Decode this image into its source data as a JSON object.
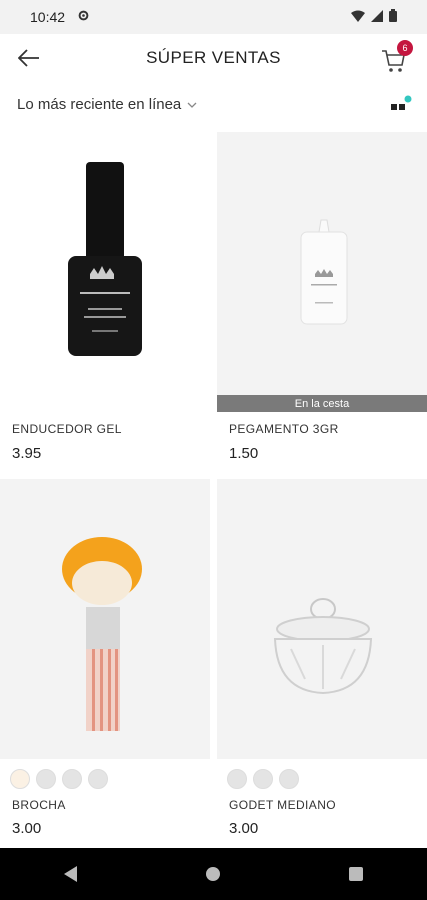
{
  "status_bar": {
    "time": "10:42"
  },
  "header": {
    "title": "SÚPER VENTAS",
    "cart_count": "6"
  },
  "filter": {
    "sort_label": "Lo más reciente en línea"
  },
  "products": [
    {
      "name": "ENDUCEDOR GEL",
      "price": "3.95"
    },
    {
      "name": "PEGAMENTO 3GR",
      "price": "1.50",
      "banner": "En la cesta"
    },
    {
      "name": "BROCHA",
      "price": "3.00"
    },
    {
      "name": "GODET MEDIANO",
      "price": "3.00"
    }
  ],
  "colors": {
    "accent": "#c4163f",
    "teal": "#33c7c0",
    "banner": "#7a7a7a"
  },
  "icons": {
    "status": [
      "gear-icon",
      "wifi-icon",
      "signal-icon",
      "battery-icon"
    ],
    "header": [
      "back-arrow-icon",
      "cart-icon"
    ],
    "nav": [
      "back-triangle-icon",
      "home-circle-icon",
      "recents-square-icon"
    ]
  }
}
